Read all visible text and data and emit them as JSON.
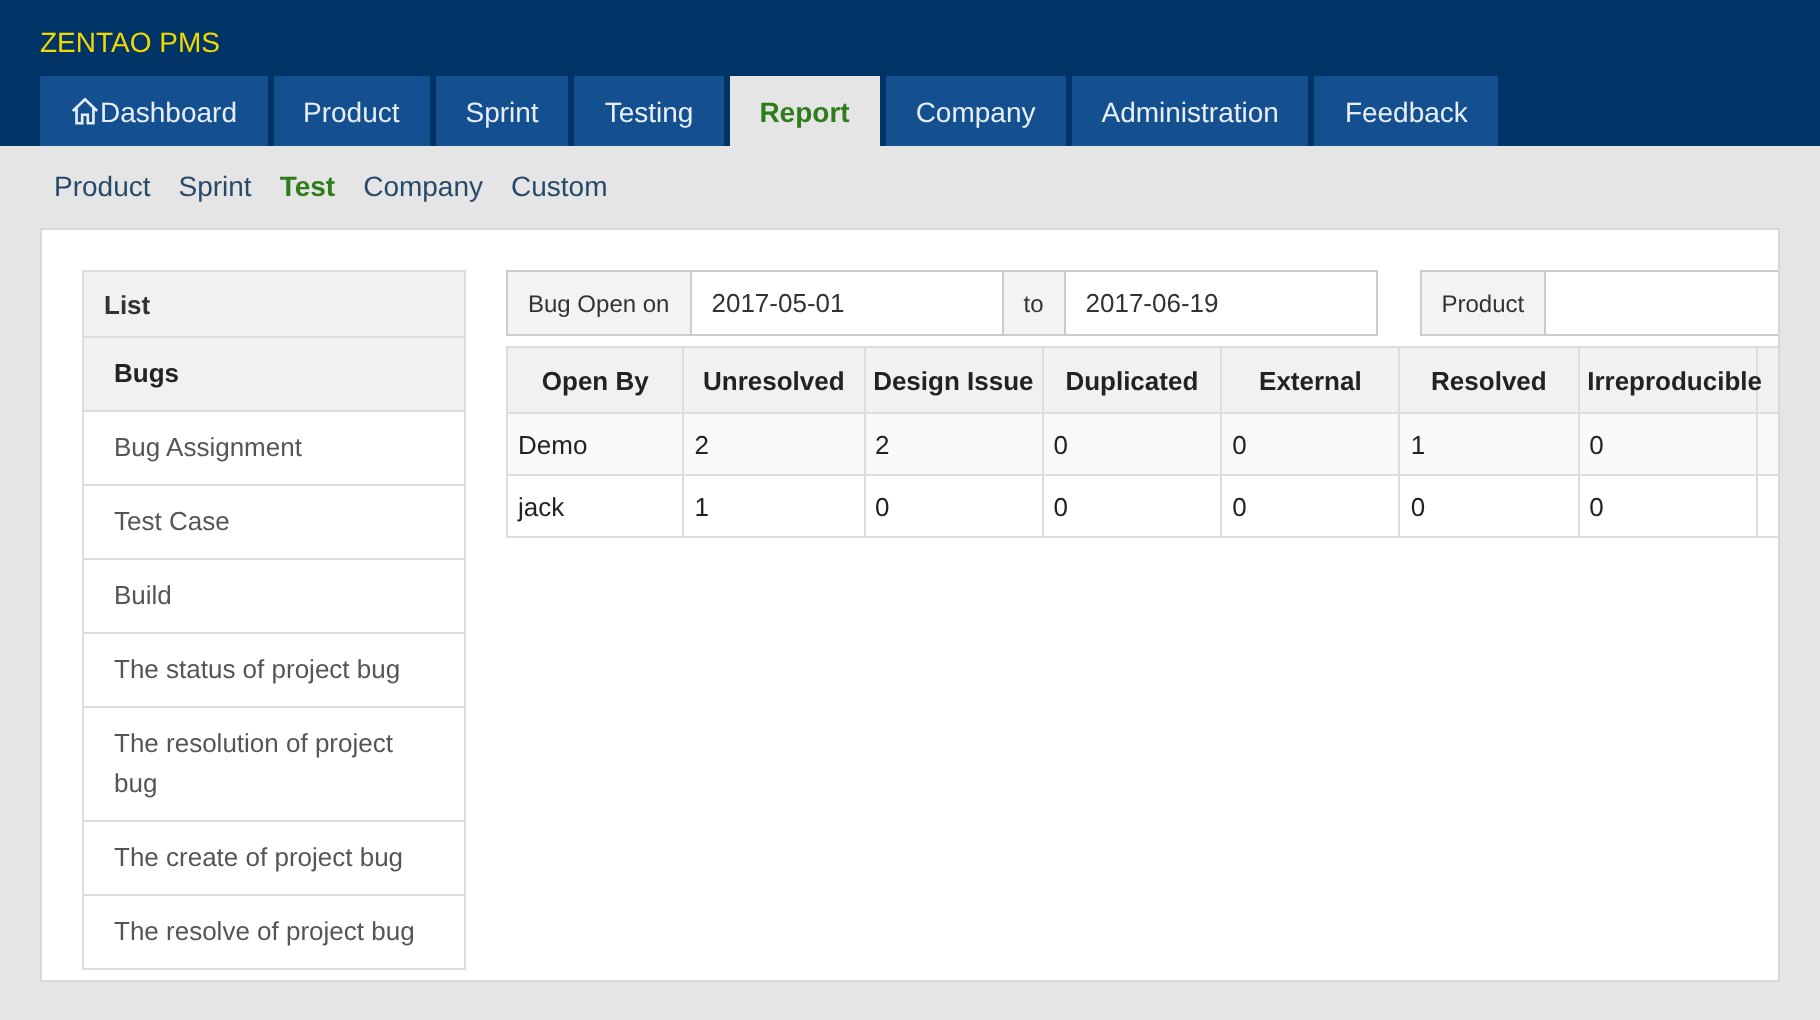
{
  "app_title": "ZENTAO PMS",
  "main_tabs": [
    {
      "label": "Dashboard",
      "kind": "home",
      "selected": false
    },
    {
      "label": "Product",
      "kind": "plain",
      "selected": false
    },
    {
      "label": "Sprint",
      "kind": "plain",
      "selected": false
    },
    {
      "label": "Testing",
      "kind": "plain",
      "selected": false
    },
    {
      "label": "Report",
      "kind": "plain",
      "selected": true
    },
    {
      "label": "Company",
      "kind": "plain",
      "selected": false
    },
    {
      "label": "Administration",
      "kind": "plain",
      "selected": false
    },
    {
      "label": "Feedback",
      "kind": "plain",
      "selected": false
    }
  ],
  "sub_nav": [
    {
      "label": "Product",
      "selected": false
    },
    {
      "label": "Sprint",
      "selected": false
    },
    {
      "label": "Test",
      "selected": true
    },
    {
      "label": "Company",
      "selected": false
    },
    {
      "label": "Custom",
      "selected": false
    }
  ],
  "sidebar": {
    "title": "List",
    "items": [
      {
        "label": "Bugs",
        "selected": true
      },
      {
        "label": "Bug Assignment",
        "selected": false
      },
      {
        "label": "Test Case",
        "selected": false
      },
      {
        "label": "Build",
        "selected": false
      },
      {
        "label": "The status of project bug",
        "selected": false
      },
      {
        "label": "The resolution of project bug",
        "selected": false
      },
      {
        "label": "The create of project bug",
        "selected": false
      },
      {
        "label": "The resolve of project bug",
        "selected": false
      }
    ]
  },
  "filters": {
    "date_label": "Bug Open on",
    "date_from": "2017-05-01",
    "to_label": "to",
    "date_to": "2017-06-19",
    "product_label": "Product"
  },
  "table": {
    "columns": [
      "Open By",
      "Unresolved",
      "Design Issue",
      "Duplicated",
      "External",
      "Resolved",
      "Irreproducible"
    ],
    "rows": [
      [
        "Demo",
        "2",
        "2",
        "0",
        "0",
        "1",
        "0"
      ],
      [
        "jack",
        "1",
        "0",
        "0",
        "0",
        "0",
        "0"
      ]
    ]
  }
}
